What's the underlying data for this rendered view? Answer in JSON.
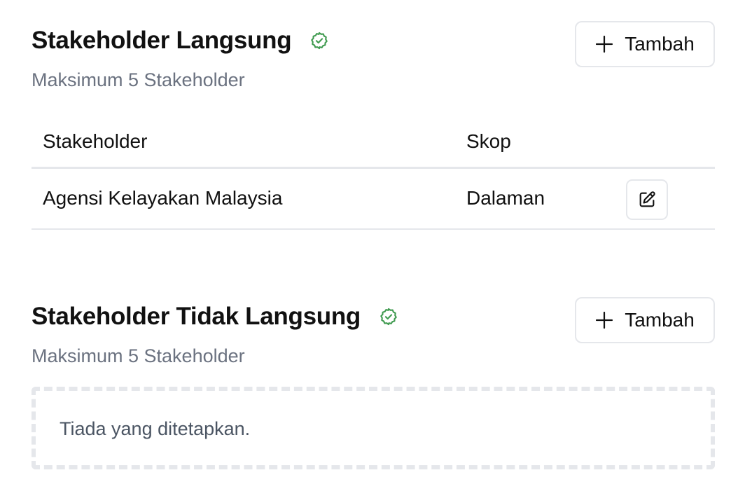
{
  "colors": {
    "verified": "#3f9a4f",
    "border": "#e5e7eb",
    "muted_text": "#6b7280",
    "text": "#111111"
  },
  "direct": {
    "title": "Stakeholder Langsung",
    "subtitle": "Maksimum 5 Stakeholder",
    "add_label": "Tambah",
    "icon": "verified-badge-icon",
    "table": {
      "columns": [
        "Stakeholder",
        "Skop"
      ],
      "rows": [
        {
          "stakeholder": "Agensi Kelayakan Malaysia",
          "skop": "Dalaman"
        }
      ]
    }
  },
  "indirect": {
    "title": "Stakeholder Tidak Langsung",
    "subtitle": "Maksimum 5 Stakeholder",
    "add_label": "Tambah",
    "icon": "verified-badge-icon",
    "empty_text": "Tiada yang ditetapkan."
  }
}
